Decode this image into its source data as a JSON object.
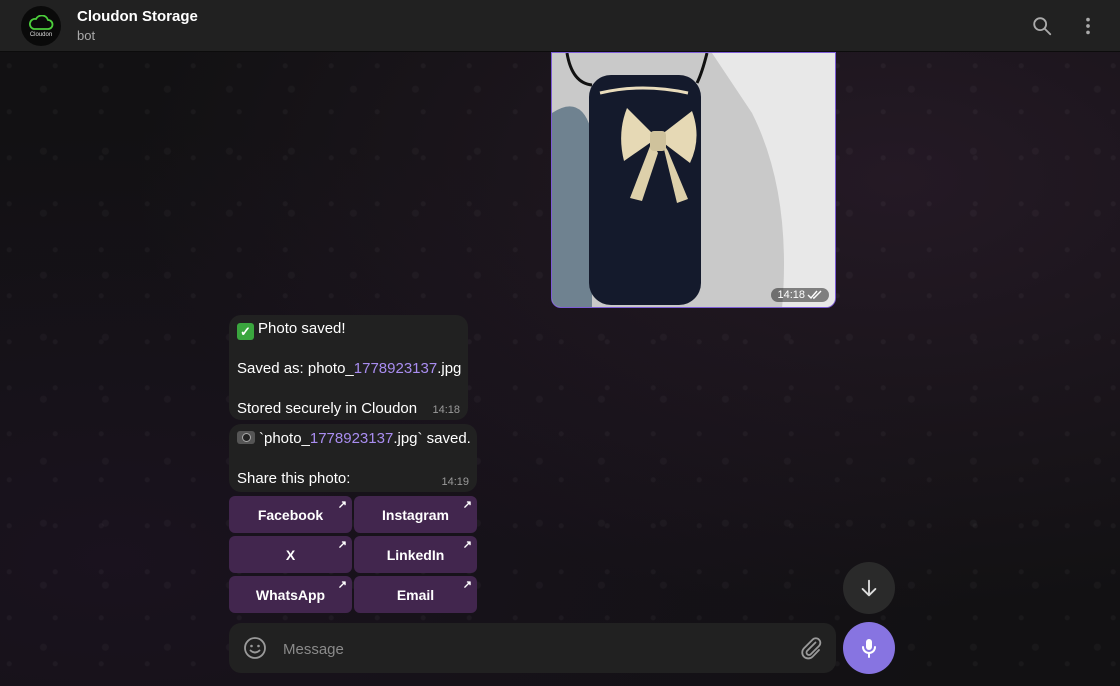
{
  "header": {
    "avatar_text": "Cloudon",
    "title": "Cloudon Storage",
    "subtitle": "bot"
  },
  "photo_message": {
    "time": "14:18"
  },
  "message1": {
    "check_emoji": "✓",
    "line1": "Photo saved!",
    "saved_prefix": "Saved as: photo_",
    "saved_number": "1778923137",
    "saved_suffix": ".jpg",
    "line3": "Stored securely in Cloudon",
    "time": "14:18"
  },
  "message2": {
    "prefix": "`photo_",
    "number": "1778923137",
    "suffix": ".jpg` saved.",
    "share": "Share this photo:",
    "time": "14:19"
  },
  "keyboard": {
    "buttons": [
      "Facebook",
      "Instagram",
      "X",
      "LinkedIn",
      "WhatsApp",
      "Email"
    ],
    "arrow": "↗"
  },
  "composer": {
    "placeholder": "Message"
  },
  "colors": {
    "accent": "#8774e1",
    "button_bg": "#42264e",
    "link_number": "#a98df0"
  }
}
